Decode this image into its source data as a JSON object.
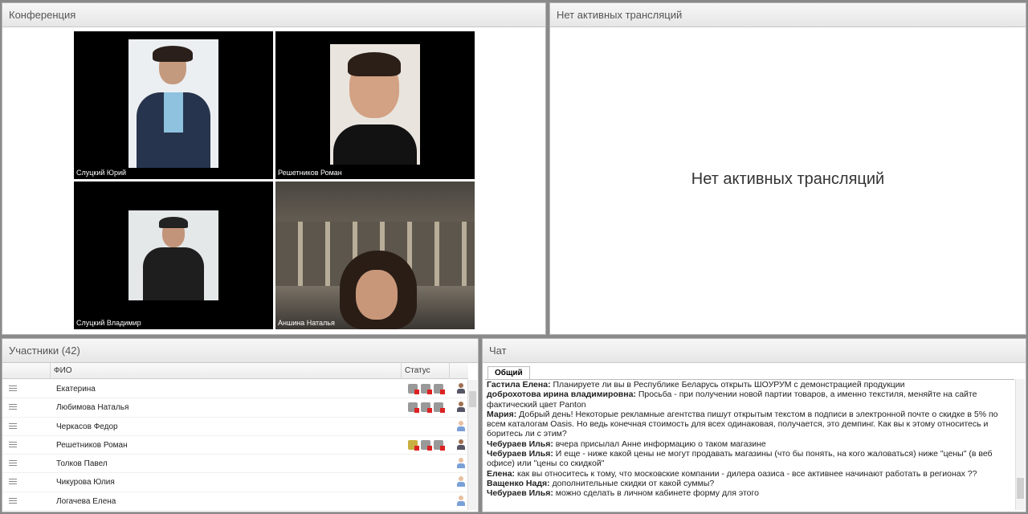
{
  "conference": {
    "title": "Конференция",
    "videos": [
      {
        "name": "Слуцкий Юрий"
      },
      {
        "name": "Решетников Роман"
      },
      {
        "name": "Слуцкий Владимир"
      },
      {
        "name": "Аншина Наталья"
      }
    ]
  },
  "stream": {
    "title": "Нет активных трансляций",
    "message": "Нет активных трансляций"
  },
  "participants": {
    "title": "Участники (42)",
    "col_fio": "ФИО",
    "col_status": "Статус",
    "rows": [
      {
        "name": "Екатерина"
      },
      {
        "name": "Любимова Наталья"
      },
      {
        "name": "Черкасов Федор"
      },
      {
        "name": "Решетников Роман"
      },
      {
        "name": "Толков Павел"
      },
      {
        "name": "Чикурова Юлия"
      },
      {
        "name": "Логачева Елена"
      }
    ]
  },
  "chat": {
    "title": "Чат",
    "tab": "Общий",
    "messages": [
      {
        "author": "Гастила Елена:",
        "text": " Планируете ли вы в Республике Беларусь открыть ШОУРУМ с демонстрацией продукции"
      },
      {
        "author": "доброхотова ирина  владимировна:",
        "text": " Просьба - при получении новой партии товаров, а именно текстиля, меняйте на сайте фактический цвет Panton"
      },
      {
        "author": "Мария:",
        "text": " Добрый день! Некоторые рекламные агентства пишут открытым текстом в подписи в электронной почте о скидке в 5% по всем каталогам Oasis. Но ведь конечная стоимость для всех одинаковая, получается, это демпинг. Как вы к этому относитесь и боритесь ли с этим?"
      },
      {
        "author": "Чебураев Илья:",
        "text": " вчера присылал Анне информацию о таком магазине"
      },
      {
        "author": "Чебураев Илья:",
        "text": " И еще - ниже какой цены не могут продавать магазины (что бы понять, на кого жаловаться) ниже \"цены\" (в веб офисе) или \"цены со скидкой\""
      },
      {
        "author": "Елена:",
        "text": " как вы относитесь к тому, что московские компании  - дилера оазиса - все активнее начинают работать в регионах ??"
      },
      {
        "author": "Ващенко  Надя:",
        "text": " дополнительные скидки от какой суммы?"
      },
      {
        "author": "Чебураев Илья:",
        "text": " можно сделать в личном кабинете форму для этого"
      }
    ]
  }
}
